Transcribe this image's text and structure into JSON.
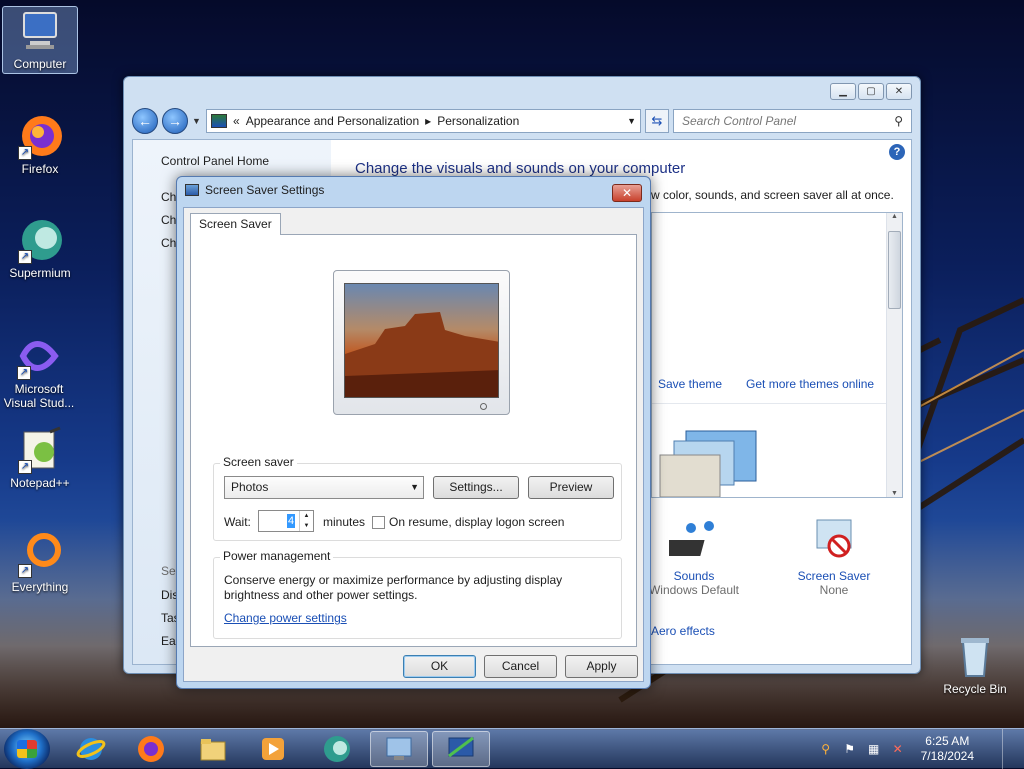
{
  "desktop": {
    "icons": [
      {
        "label": "Computer"
      },
      {
        "label": "Firefox"
      },
      {
        "label": "Supermium"
      },
      {
        "label": "Microsoft Visual Stud..."
      },
      {
        "label": "Notepad++"
      },
      {
        "label": "Everything"
      },
      {
        "label": "Recycle Bin"
      }
    ]
  },
  "control_panel": {
    "breadcrumb_sep": "«",
    "breadcrumb": [
      "Appearance and Personalization",
      "Personalization"
    ],
    "breadcrumb_arrow": "▸",
    "search_placeholder": "Search Control Panel",
    "left_home": "Control Panel Home",
    "left_partial": [
      "Ch",
      "Ch",
      "Ch"
    ],
    "left_bottom_partial": [
      "See",
      "Dis",
      "Tas",
      "Eas"
    ],
    "title": "Change the visuals and sounds on your computer",
    "subtitle": "w color, sounds, and screen saver all at once.",
    "save_theme": "Save theme",
    "get_more_themes": "Get more themes online",
    "sounds": {
      "name": "Sounds",
      "value": "Windows Default"
    },
    "screen_saver": {
      "name": "Screen Saver",
      "value": "None"
    },
    "aero_effects": "Aero effects",
    "help_glyph": "?"
  },
  "dialog": {
    "title": "Screen Saver Settings",
    "close_glyph": "✕",
    "tab": "Screen Saver",
    "screen_saver_group": "Screen saver",
    "selected": "Photos",
    "settings_btn": "Settings...",
    "preview_btn": "Preview",
    "wait_label": "Wait:",
    "wait_value": "4",
    "minutes": "minutes",
    "on_resume": "On resume, display logon screen",
    "power_group": "Power management",
    "power_text": "Conserve energy or maximize performance by adjusting display brightness and other power settings.",
    "power_link": "Change power settings",
    "ok": "OK",
    "cancel": "Cancel",
    "apply": "Apply"
  },
  "taskbar": {
    "time": "6:25 AM",
    "date": "7/18/2024"
  }
}
